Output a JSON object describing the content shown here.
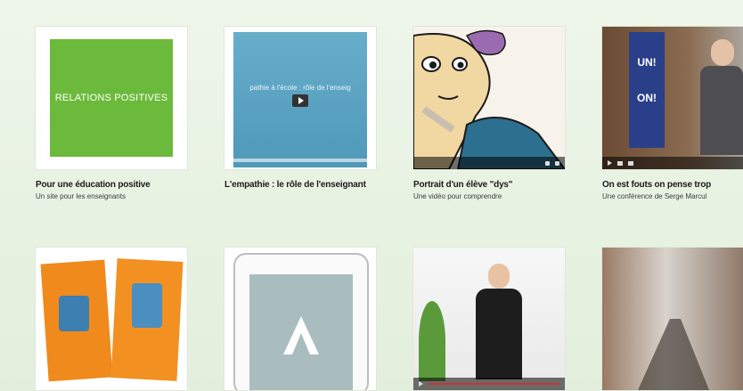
{
  "cards": [
    {
      "thumb_text": "RELATIONS POSITIVES",
      "title": "Pour une éducation positive",
      "subtitle": "Un site pour les enseignants"
    },
    {
      "thumb_text": "pathie à l'école : rôle de l'enseig",
      "title": "L'empathie : le rôle de l'enseignant",
      "subtitle": ""
    },
    {
      "thumb_text": "",
      "title": "Portrait d'un élève \"dys\"",
      "subtitle": "Une vidéo pour comprendre"
    },
    {
      "thumb_text": "UN! ON!",
      "title": "On est fouts on pense trop",
      "subtitle": "Une conférence de Serge Marcul"
    },
    {
      "thumb_text": "",
      "title": "",
      "subtitle": ""
    },
    {
      "thumb_text": "",
      "title": "",
      "subtitle": ""
    },
    {
      "thumb_text": "",
      "title": "",
      "subtitle": ""
    },
    {
      "thumb_text": "",
      "title": "",
      "subtitle": ""
    }
  ],
  "colors": {
    "green": "#6cba3b",
    "video_blue": "#5ea7c7",
    "orange": "#f08a1c"
  }
}
